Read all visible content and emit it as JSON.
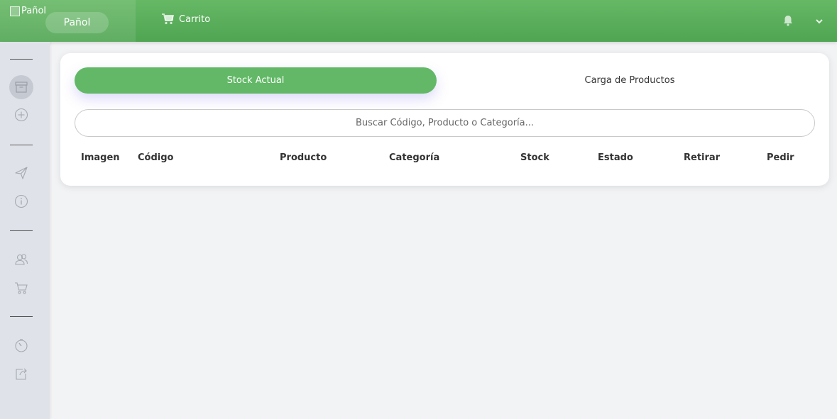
{
  "header": {
    "logo_alt": "Pañol",
    "brand_label": "Pañol",
    "cart_label": "Carrito"
  },
  "sidebar": {
    "icons": [
      "archive-icon",
      "plus-circle-icon",
      "send-icon",
      "info-icon",
      "users-icon",
      "cart-icon",
      "timer-icon",
      "share-icon"
    ]
  },
  "tabs": {
    "active_label": "Stock Actual",
    "inactive_label": "Carga de Productos"
  },
  "search": {
    "placeholder": "Buscar Código, Producto o Categoría..."
  },
  "table": {
    "columns": [
      "Imagen",
      "Código",
      "Producto",
      "Categoría",
      "Stock",
      "Estado",
      "Retirar",
      "Pedir"
    ]
  },
  "colors": {
    "accent": "#62b866",
    "topbar": "#5aaf5c"
  }
}
